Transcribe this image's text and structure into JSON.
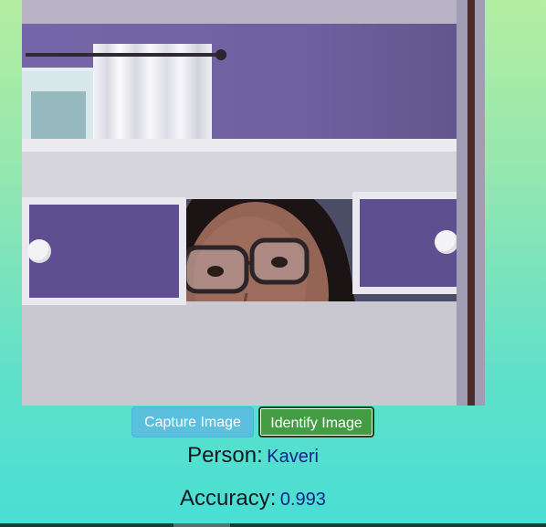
{
  "webcam": {
    "subject": "webcam snapshot of a girl with glasses in a room with purple walls"
  },
  "buttons": {
    "capture_label": "Capture Image",
    "identify_label": "Identify Image"
  },
  "result": {
    "person_label": "Person:",
    "person_value": "Kaveri",
    "accuracy_label": "Accuracy:",
    "accuracy_value": "0.993"
  },
  "colors": {
    "capture_button": "#5bc0de",
    "identify_button": "#449d44",
    "result_value": "#16248a",
    "background_top": "#b4eea0",
    "background_bottom": "#48dfd4"
  }
}
